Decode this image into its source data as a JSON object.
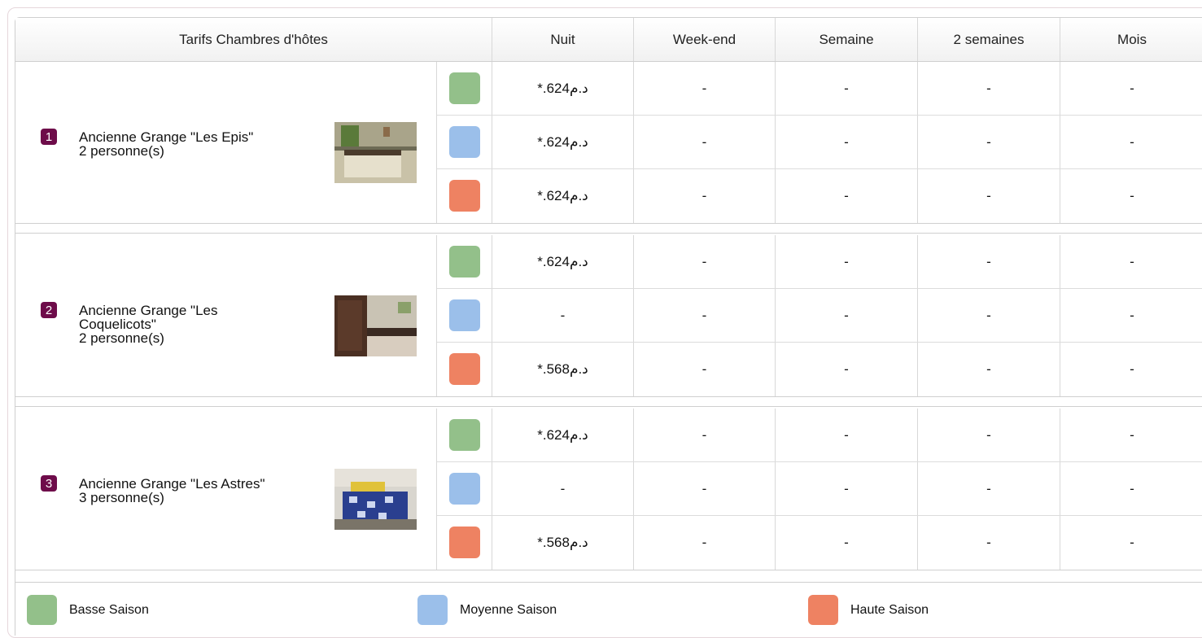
{
  "colors": {
    "basse": "#93c08a",
    "moyenne": "#9bbfea",
    "haute": "#ee8262",
    "badge": "#6e0c4a"
  },
  "header": {
    "title": "Tarifs Chambres d'hôtes",
    "columns": [
      "Nuit",
      "Week-end",
      "Semaine",
      "2 semaines",
      "Mois"
    ]
  },
  "rooms": [
    {
      "number": "1",
      "name": "Ancienne Grange \"Les Epis\"",
      "capacity": "2 personne(s)",
      "photo_icon": "bedroom-photo",
      "prices": [
        {
          "season": "basse",
          "cells": [
            "*.د.م624",
            "-",
            "-",
            "-",
            "-"
          ]
        },
        {
          "season": "moyenne",
          "cells": [
            "*.د.م624",
            "-",
            "-",
            "-",
            "-"
          ]
        },
        {
          "season": "haute",
          "cells": [
            "*.د.م624",
            "-",
            "-",
            "-",
            "-"
          ]
        }
      ]
    },
    {
      "number": "2",
      "name": "Ancienne Grange \"Les Coquelicots\"",
      "capacity": "2 personne(s)",
      "photo_icon": "bedroom-photo",
      "prices": [
        {
          "season": "basse",
          "cells": [
            "*.د.م624",
            "-",
            "-",
            "-",
            "-"
          ]
        },
        {
          "season": "moyenne",
          "cells": [
            "-",
            "-",
            "-",
            "-",
            "-"
          ]
        },
        {
          "season": "haute",
          "cells": [
            "*.د.م568",
            "-",
            "-",
            "-",
            "-"
          ]
        }
      ]
    },
    {
      "number": "3",
      "name": "Ancienne Grange \"Les Astres\"",
      "capacity": "3 personne(s)",
      "photo_icon": "bedroom-photo",
      "prices": [
        {
          "season": "basse",
          "cells": [
            "*.د.م624",
            "-",
            "-",
            "-",
            "-"
          ]
        },
        {
          "season": "moyenne",
          "cells": [
            "-",
            "-",
            "-",
            "-",
            "-"
          ]
        },
        {
          "season": "haute",
          "cells": [
            "*.د.م568",
            "-",
            "-",
            "-",
            "-"
          ]
        }
      ]
    }
  ],
  "legend": [
    {
      "season": "basse",
      "label": "Basse Saison"
    },
    {
      "season": "moyenne",
      "label": "Moyenne Saison"
    },
    {
      "season": "haute",
      "label": "Haute Saison"
    }
  ]
}
